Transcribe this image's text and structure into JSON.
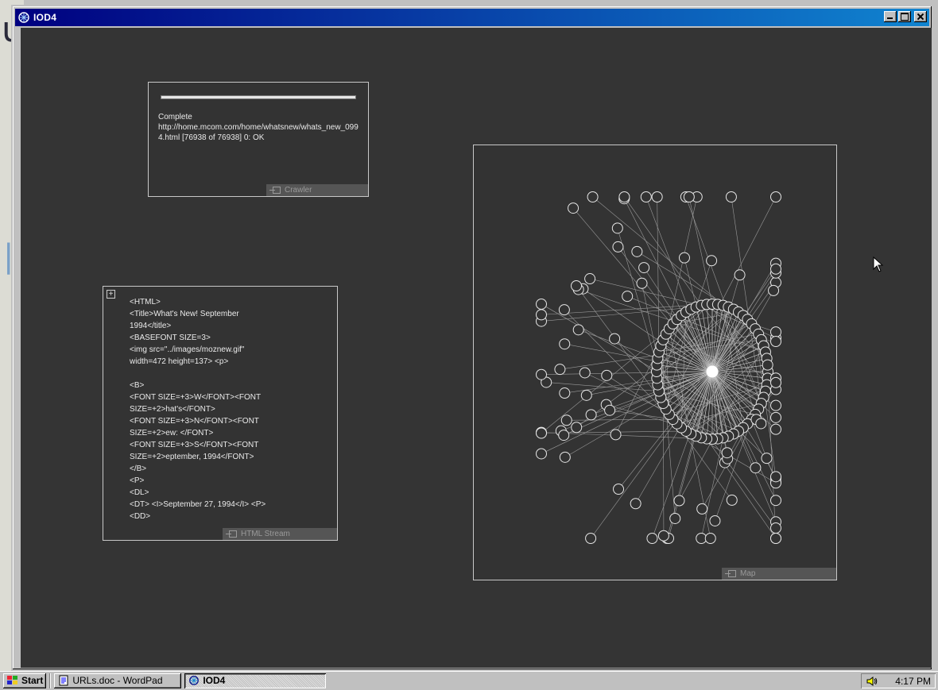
{
  "window": {
    "title": "IOD4"
  },
  "crawler": {
    "status": "Complete",
    "detail": "http://home.mcom.com/home/whatsnew/whats_new_0994.html [76938 of 76938] 0: OK",
    "label": "Crawler",
    "progress": 1.0
  },
  "html_stream": {
    "label": "HTML Stream",
    "code": "<HTML>\n<Title>What's New! September\n1994</title>\n<BASEFONT SIZE=3>\n<img src=\"../images/moznew.gif\"\nwidth=472 height=137> <p>\n\n<B>\n<FONT SIZE=+3>W</FONT><FONT\nSIZE=+2>hat's</FONT>\n<FONT SIZE=+3>N</FONT><FONT\nSIZE=+2>ew: </FONT>\n<FONT SIZE=+3>S</FONT><FONT\nSIZE=+2>eptember, 1994</FONT>\n</B>\n<P>\n<DL>\n<DT> <I>September 27, 1994</I> <P>\n<DD>"
  },
  "map": {
    "label": "Map"
  },
  "taskbar": {
    "start_label": "Start",
    "tasks": [
      {
        "label": "URLs.doc - WordPad",
        "active": false
      },
      {
        "label": "IOD4",
        "active": true
      }
    ],
    "clock": "4:17 PM"
  },
  "colors": {
    "titlebar": "#000080",
    "client": "#343434",
    "panel_border": "#c8c8c8"
  },
  "icons": [
    "app-icon",
    "minimize-icon",
    "maximize-icon",
    "close-icon",
    "start-icon",
    "wordpad-icon",
    "speaker-icon",
    "cursor-icon"
  ]
}
